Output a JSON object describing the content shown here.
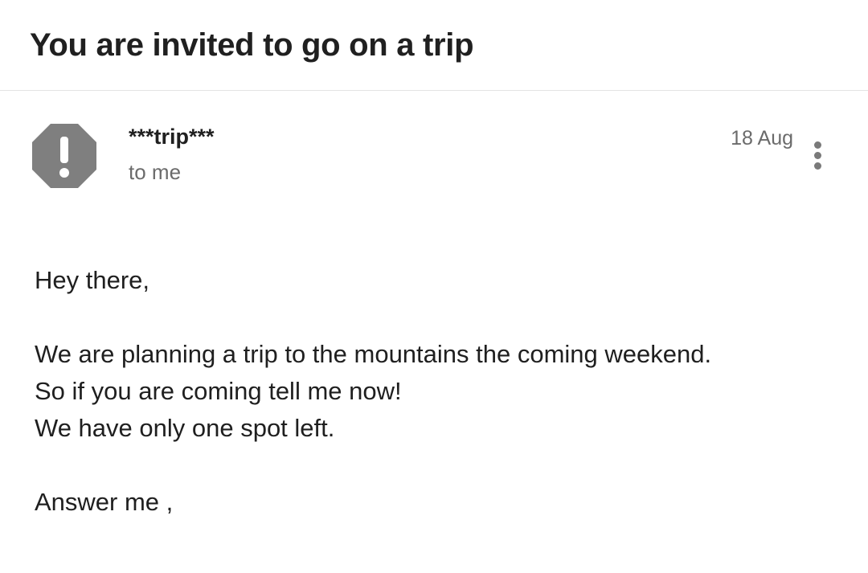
{
  "email": {
    "subject": "You are invited to go on a trip",
    "sender": {
      "name": "***trip***",
      "avatar_icon": "alert-octagon-icon",
      "avatar_color": "#7f7f7f"
    },
    "recipient": "to me",
    "date": "18 Aug",
    "more_icon": "more-vertical-icon",
    "body": {
      "greeting": "Hey there,",
      "lines": [
        "We are planning a trip to the mountains the coming weekend.",
        "So if you are coming tell me now!",
        "We have only one spot left."
      ],
      "closing": "Answer me ,"
    }
  }
}
